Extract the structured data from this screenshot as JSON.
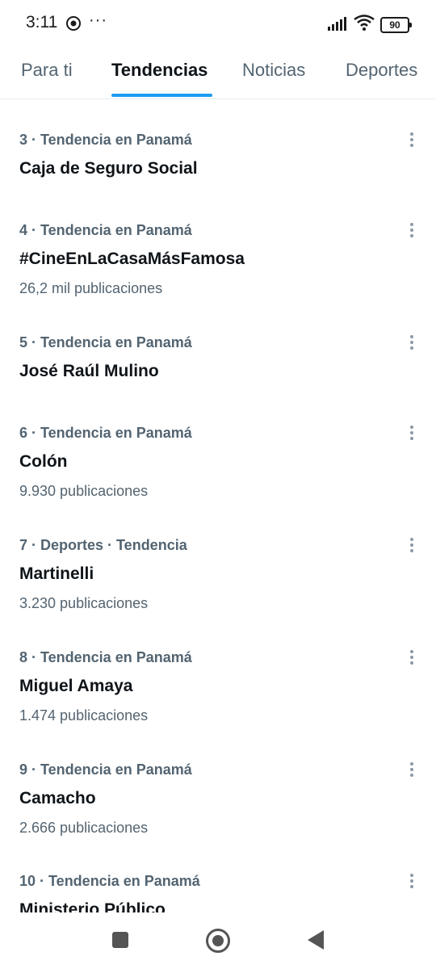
{
  "status_bar": {
    "time": "3:11",
    "more": "···",
    "battery": "90"
  },
  "tabs": [
    {
      "label": "Para ti",
      "active": false
    },
    {
      "label": "Tendencias",
      "active": true
    },
    {
      "label": "Noticias",
      "active": false
    },
    {
      "label": "Deportes",
      "active": false
    }
  ],
  "colors": {
    "accent": "#1d9bf0",
    "secondary_text": "#536471",
    "primary_text": "#0f1419"
  },
  "trends": [
    {
      "meta": "3 · Tendencia en Panamá",
      "name": "Caja de Seguro Social",
      "count": ""
    },
    {
      "meta": "4 · Tendencia en Panamá",
      "name": "#CineEnLaCasaMásFamosa",
      "count": "26,2 mil publicaciones"
    },
    {
      "meta": "5 · Tendencia en Panamá",
      "name": "José Raúl Mulino",
      "count": ""
    },
    {
      "meta": "6 · Tendencia en Panamá",
      "name": "Colón",
      "count": "9.930 publicaciones"
    },
    {
      "meta": "7 · Deportes · Tendencia",
      "name": "Martinelli",
      "count": "3.230 publicaciones"
    },
    {
      "meta": "8 · Tendencia en Panamá",
      "name": "Miguel Amaya",
      "count": "1.474 publicaciones"
    },
    {
      "meta": "9 · Tendencia en Panamá",
      "name": "Camacho",
      "count": "2.666 publicaciones"
    },
    {
      "meta": "10 · Tendencia en Panamá",
      "name": "Ministerio Público",
      "count": ""
    }
  ],
  "icons": {
    "menu": "more-vertical-icon",
    "nav": [
      "recent-apps-icon",
      "home-icon",
      "back-icon"
    ]
  }
}
